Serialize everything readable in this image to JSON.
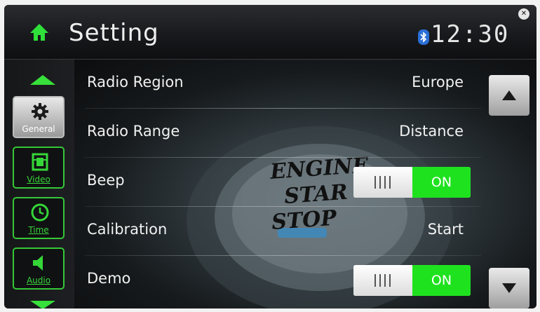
{
  "header": {
    "title": "Setting",
    "clock": "12:30",
    "home_icon": "home-icon",
    "bluetooth_icon": "bluetooth-icon",
    "corner_icon": "close-icon"
  },
  "sidebar": {
    "items": [
      {
        "label": "General",
        "icon": "gear-icon",
        "active": true
      },
      {
        "label": "Video",
        "icon": "film-icon",
        "active": false
      },
      {
        "label": "Time",
        "icon": "clock-icon",
        "active": false
      },
      {
        "label": "Audio",
        "icon": "speaker-icon",
        "active": false
      }
    ]
  },
  "settings": {
    "rows": [
      {
        "label": "Radio Region",
        "value": "Europe"
      },
      {
        "label": "Radio Range",
        "value": "Distance"
      },
      {
        "label": "Beep",
        "toggle": "ON"
      },
      {
        "label": "Calibration",
        "value": "Start"
      },
      {
        "label": "Demo",
        "toggle": "ON"
      }
    ]
  },
  "background": {
    "text_line1": "ENGINE",
    "text_line2": "STAR",
    "text_line3": "STOP"
  },
  "colors": {
    "accent_green": "#1fe21f",
    "sidebar_green": "#37e03a",
    "background": "#0c0d10"
  }
}
